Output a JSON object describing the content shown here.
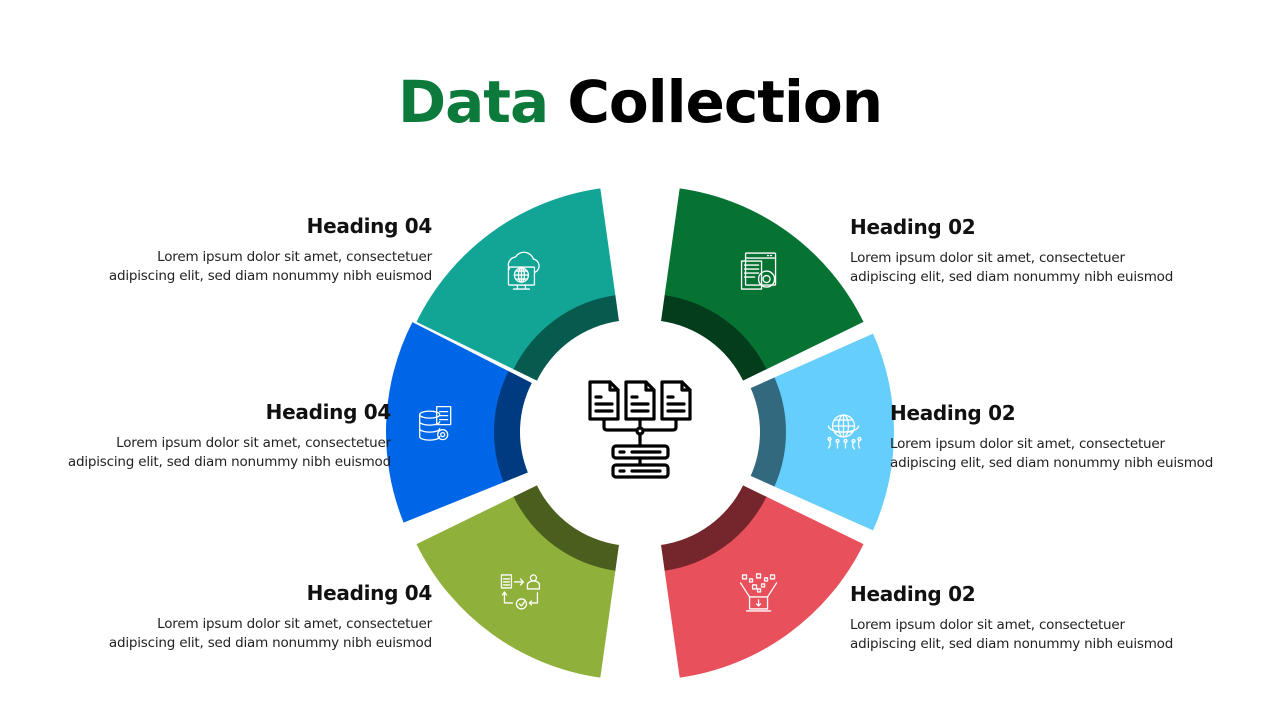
{
  "title": {
    "accent": "Data",
    "rest": "Collection",
    "accent_color": "#0b7a3a"
  },
  "center_icon": "data-server-network-icon",
  "segments": [
    {
      "id": "top-left",
      "heading": "Heading 04",
      "text_line1": "Lorem  ipsum  dolor  sit amet,  consectetuer",
      "text_line2": "adipiscing elit, sed diam nonummy  nibh euismod",
      "color": "#12a596",
      "dark": "#075a4e",
      "icon": "cloud-computer-globe-icon"
    },
    {
      "id": "middle-left",
      "heading": "Heading 04",
      "text_line1": "Lorem  ipsum  dolor  sit amet,  consectetuer",
      "text_line2": "adipiscing elit, sed diam nonummy  nibh euismod",
      "color": "#0066e8",
      "dark": "#003a80",
      "icon": "database-document-gear-icon"
    },
    {
      "id": "bottom-left",
      "heading": "Heading 04",
      "text_line1": "Lorem  ipsum  dolor  sit amet,  consectetuer",
      "text_line2": "adipiscing elit, sed diam nonummy  nibh euismod",
      "color": "#8fb03a",
      "dark": "#4a5e1e",
      "icon": "workflow-approval-icon"
    },
    {
      "id": "top-right",
      "heading": "Heading 02",
      "text_line1": "Lorem  ipsum  dolor  sit amet,  consectetuer",
      "text_line2": "adipiscing elit, sed diam nonummy  nibh euismod",
      "color": "#067333",
      "dark": "#033d1b",
      "icon": "web-document-settings-icon"
    },
    {
      "id": "middle-right",
      "heading": "Heading 02",
      "text_line1": "Lorem  ipsum  dolor  sit amet,  consectetuer",
      "text_line2": "adipiscing elit, sed diam nonummy  nibh euismod",
      "color": "#66cefa",
      "dark": "#33697f",
      "icon": "global-network-icon"
    },
    {
      "id": "bottom-right",
      "heading": "Heading 02",
      "text_line1": "Lorem  ipsum  dolor  sit amet,  consectetuer",
      "text_line2": "adipiscing elit, sed diam nonummy  nibh euismod",
      "color": "#e8505b",
      "dark": "#75252c",
      "icon": "data-download-laptop-icon"
    }
  ]
}
